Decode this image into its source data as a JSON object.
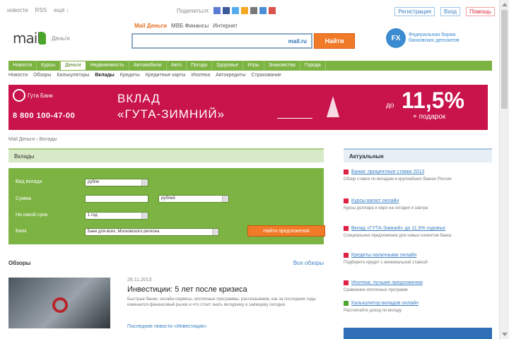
{
  "topbar": {
    "left_links": [
      "новости",
      "RSS",
      "ещё ↓"
    ],
    "share_label": "Поделиться:",
    "share_colors": [
      "#5b7bd5",
      "#3b5998",
      "#55acee",
      "#f5a623",
      "#777777",
      "#4a90d9",
      "#d9534f"
    ],
    "register": "Регистрация",
    "login": "Вход",
    "help": "Помощь"
  },
  "header": {
    "logo_text": "mail",
    "logo_sub": "Деньги",
    "search_tabs": [
      "Mail Деньги",
      "МВБ Финансы",
      "Интернет"
    ],
    "search_engine": "mail.ru",
    "search_button": "Найти",
    "partner_logo": "FX",
    "partner_text": "Федеральная биржа банковских депозитов"
  },
  "nav": {
    "items": [
      "Новости",
      "Курсы",
      "Деньги",
      "Недвижимость",
      "Автомобили",
      "Авто",
      "Погода",
      "Здоровье",
      "Игры",
      "Знакомства",
      "Города"
    ],
    "active_index": 2
  },
  "subnav": {
    "items": [
      "Новости",
      "Обзоры",
      "Калькуляторы",
      "Вклады",
      "Кредиты",
      "Кредитные карты",
      "Ипотека",
      "Автокредиты",
      "Страхование"
    ],
    "current_index": 3
  },
  "banner": {
    "brand": "Гута Банк",
    "phone": "8 800 100-47-00",
    "title_line1": "ВКЛАД",
    "title_line2": "«ГУТА-ЗИМНИЙ»",
    "rate_prefix": "до",
    "rate": "11,5%",
    "gift": "+ подарок"
  },
  "breadcrumb": "Mail Деньги › Вклады",
  "deposit_section": {
    "title": "Вклады",
    "labels": [
      "Вид вклада",
      "Сумма",
      "На какой срок",
      "Банк"
    ],
    "currency_value": "рубли",
    "amount_value": "",
    "period_unit": "рублей",
    "term_value": "1 год",
    "bank_value": "Банк для всех, Московского региона",
    "submit": "Найти предложения"
  },
  "news": {
    "title": "Обзоры",
    "all_link": "Все обзоры",
    "date": "28.11.2013",
    "headline": "Инвестиции: 5 лет после кризиса",
    "excerpt": "Быстрые банки, онлайн-сервисы, ипотечные программы: рассказываем, как за последние годы изменился финансовый рынок и что стоит знать вкладчику и заёмщику сегодня.",
    "link": "Последние новости «Инвестиции»"
  },
  "sidebar": {
    "title": "Актуальные",
    "items": [
      {
        "link": "Банки: процентные ставки 2013",
        "desc": "Обзор ставок по вкладам в крупнейших банках России",
        "color": "#d9534f"
      },
      {
        "link": "Курсы валют онлайн",
        "desc": "Курсы доллара и евро на сегодня и завтра",
        "color": "#d9534f"
      },
      {
        "link": "Вклад «ГУТА-Зимний» до 11,5% годовых",
        "desc": "Специальное предложение для новых клиентов банка",
        "color": "#d9534f"
      },
      {
        "link": "Кредиты наличными онлайн",
        "desc": "Подберите кредит с минимальной ставкой",
        "color": "#d9534f"
      },
      {
        "link": "Ипотека: лучшие предложения",
        "desc": "Сравнение ипотечных программ",
        "color": "#d9534f"
      },
      {
        "link": "Калькулятор вкладов онлайн",
        "desc": "Рассчитайте доход по вкладу",
        "color": "#4aa52a"
      }
    ]
  }
}
